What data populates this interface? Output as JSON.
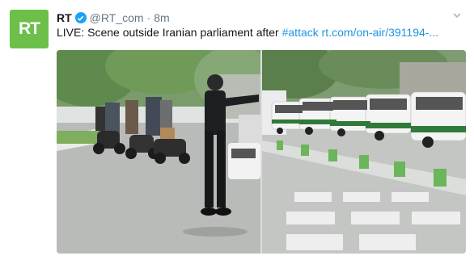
{
  "account": {
    "avatar_text": "RT",
    "name": "RT",
    "handle": "@RT_com",
    "separator": "·",
    "time": "8m"
  },
  "tweet": {
    "text_prefix": "LIVE: Scene outside Iranian parliament after ",
    "hashtag": "#attack",
    "link": "rt.com/on-air/391194-..."
  },
  "media": {
    "photos": [
      {
        "label": "street-scene-officer-directing-traffic"
      },
      {
        "label": "row-of-police-vans-on-street"
      }
    ]
  },
  "colors": {
    "brand_green": "#6cc04a",
    "link_blue": "#1b95e0",
    "verified_blue": "#1da1f2"
  }
}
